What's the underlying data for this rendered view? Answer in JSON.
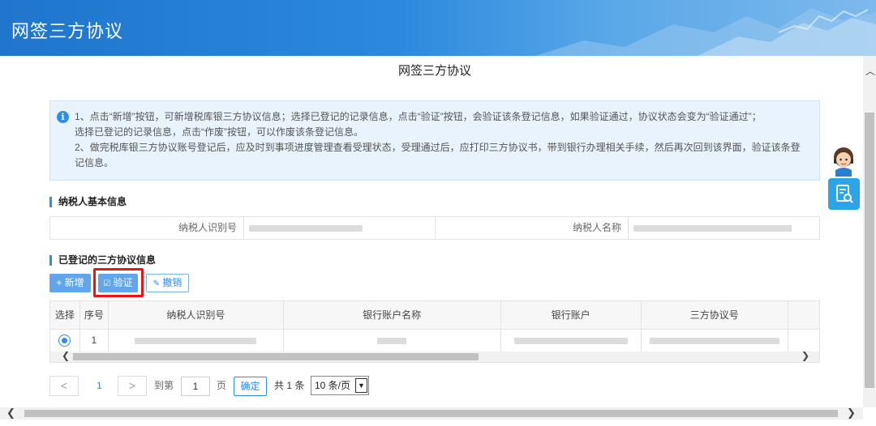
{
  "banner": {
    "title": "网签三方协议"
  },
  "page": {
    "title": "网签三方协议"
  },
  "notice": {
    "line1": "1、点击“新增”按钮，可新增税库银三方协议信息；选择已登记的记录信息，点击“验证”按钮，会验证该条登记信息，如果验证通过，协议状态会变为“验证通过”；",
    "line2": "选择已登记的记录信息，点击“作废”按钮，可以作废该条登记信息。",
    "line3": "2、做完税库银三方协议账号登记后，应及时到事项进度管理查看受理状态，受理通过后，应打印三方协议书，带到银行办理相关手续，然后再次回到该界面，验证该条登",
    "line4": "记信息。"
  },
  "taxpayer_section": {
    "title": "纳税人基本信息",
    "id_label": "纳税人识别号",
    "name_label": "纳税人名称"
  },
  "agreement_section": {
    "title": "已登记的三方协议信息",
    "add_label": "新增",
    "verify_label": "验证",
    "cancel_label": "撤销"
  },
  "table": {
    "headers": [
      "选择",
      "序号",
      "纳税人识别号",
      "银行账户名称",
      "银行账户",
      "三方协议号"
    ],
    "rows": [
      {
        "index": "1"
      }
    ]
  },
  "pager": {
    "prev": "<",
    "current_page": "1",
    "next": ">",
    "goto_label": "到第",
    "goto_value": "1",
    "page_unit": "页",
    "confirm_label": "确定",
    "total_label": "共 1 条",
    "page_size": "10 条/页"
  },
  "icons": {
    "info": "info-icon",
    "add": "plus-icon",
    "verify": "check-square-icon",
    "cancel": "edit-icon",
    "float": "document-search-icon",
    "avatar": "customer-service-avatar"
  },
  "colors": {
    "banner": "#2b88dd",
    "accent": "#2d8cf0",
    "highlight": "#e8141b",
    "button": "#61a6ec"
  }
}
